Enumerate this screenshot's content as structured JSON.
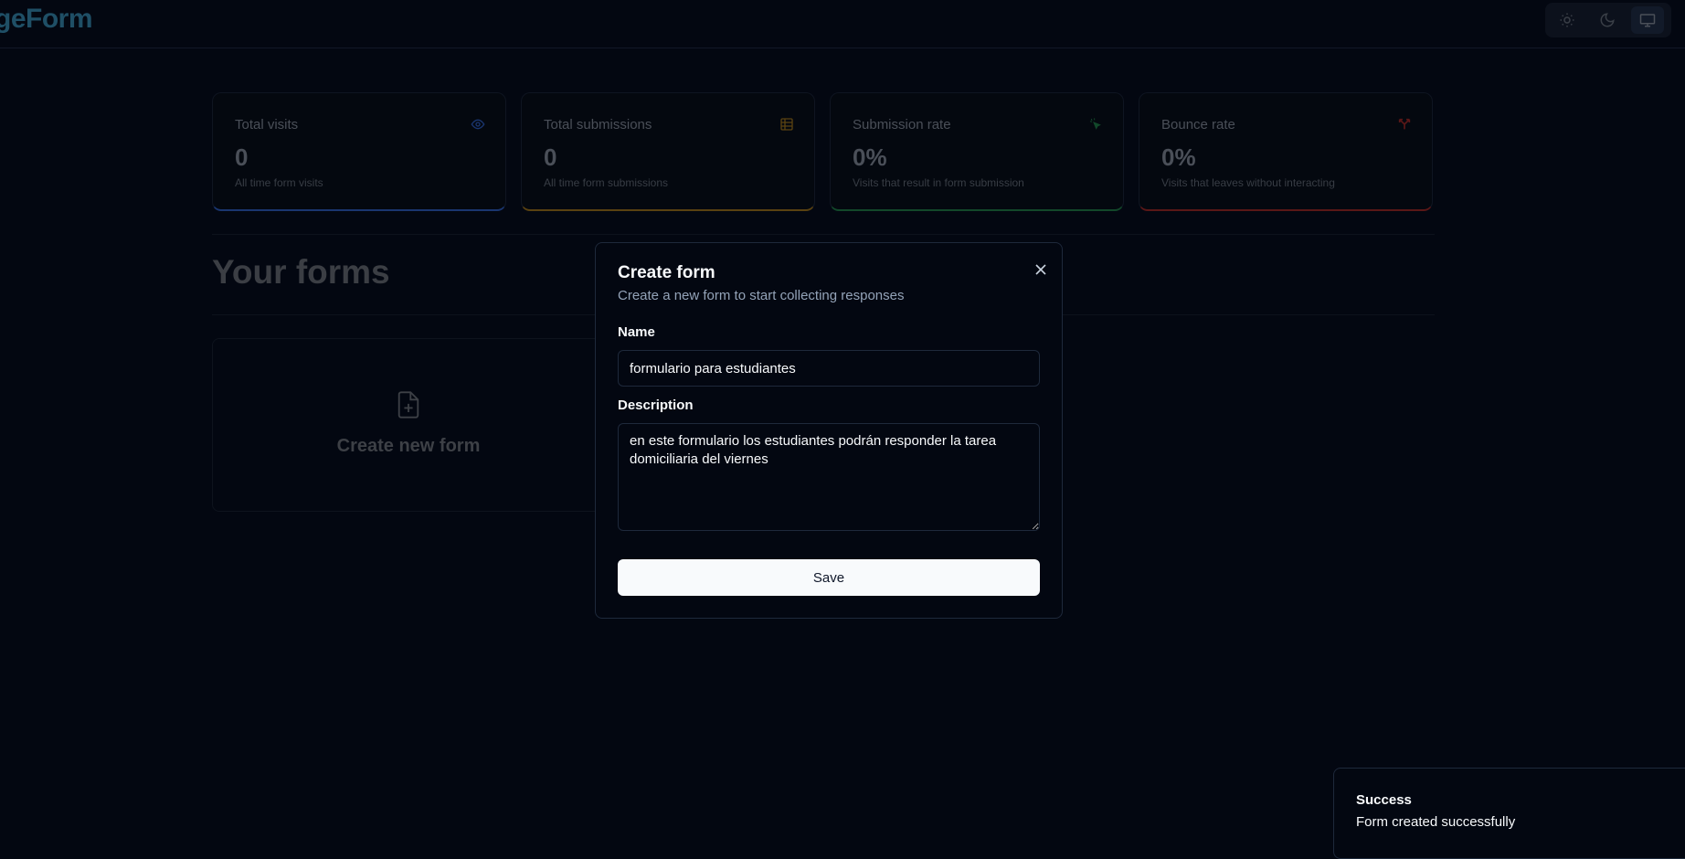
{
  "header": {
    "logo": "PageForm",
    "visible_logo": "geForm",
    "theme_options": [
      {
        "name": "light",
        "icon": "sun-icon"
      },
      {
        "name": "dark",
        "icon": "moon-icon"
      },
      {
        "name": "system",
        "icon": "monitor-icon"
      }
    ]
  },
  "stats": [
    {
      "title": "Total visits",
      "value": "0",
      "helper": "All time form visits",
      "icon": "eye-icon",
      "accent": "#1a3670"
    },
    {
      "title": "Total submissions",
      "value": "0",
      "helper": "All time form submissions",
      "icon": "table-icon",
      "accent": "#5a4211"
    },
    {
      "title": "Submission rate",
      "value": "0%",
      "helper": "Visits that result in form submission",
      "icon": "cursor-click-icon",
      "accent": "#12482a"
    },
    {
      "title": "Bounce rate",
      "value": "0%",
      "helper": "Visits that leaves without interacting",
      "icon": "split-arrow-icon",
      "accent": "#5a1717"
    }
  ],
  "main": {
    "section_title": "Your forms",
    "create_card_label": "Create new form"
  },
  "modal": {
    "title": "Create form",
    "description": "Create a new form to start collecting responses",
    "name_label": "Name",
    "name_value": "formulario para estudiantes",
    "description_label": "Description",
    "description_value": "en este formulario los estudiantes podrán responder la tarea domiciliaria del viernes",
    "save_label": "Save"
  },
  "toast": {
    "title": "Success",
    "description": "Form created successfully"
  }
}
